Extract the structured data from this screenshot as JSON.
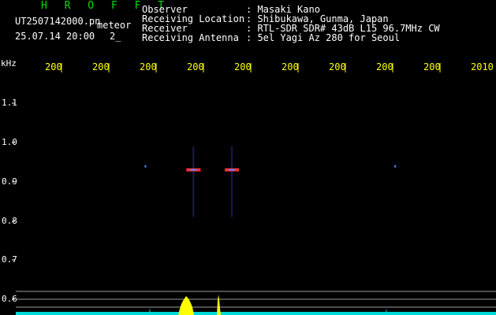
{
  "header": {
    "title": "H R O F F T",
    "filename": "UT2507142000.pn",
    "meteor_label": "meteor",
    "datetime": "25.07.14 20:00",
    "count": "2_"
  },
  "info": [
    {
      "key": "Observer",
      "value": ": Masaki Kano"
    },
    {
      "key": "Receiving Location",
      "value": ": Shibukawa, Gunma, Japan"
    },
    {
      "key": "Receiver",
      "value": ": RTL-SDR SDR# 43dB L15 96.7MHz CW"
    },
    {
      "key": "Receiving Antenna",
      "value": ": 5el Yagi Az 280 for Seoul"
    }
  ],
  "chart_data": {
    "type": "heatmap",
    "ylabel": "kHz",
    "x_ticks": [
      "200",
      "200",
      "200",
      "200",
      "200",
      "200",
      "200",
      "200",
      "200",
      "2010"
    ],
    "y_ticks": [
      "1.1",
      "1.0",
      "0.9",
      "0.8",
      "0.7",
      "0.6"
    ],
    "ylim": [
      0.6,
      1.1
    ],
    "colors": {
      "background": "#000000",
      "x_tick": "#ffff00",
      "y_tick": "#ffffff",
      "signal": "#ff3030",
      "echo_core": "#6080ff",
      "spectrum": "#ffff00",
      "baseline": "#00d8d8",
      "grid": "#9a9a9a"
    },
    "echoes": [
      {
        "x": 0.27,
        "f": 0.94,
        "intensity": "weak"
      },
      {
        "x": 0.37,
        "f": 0.93,
        "intensity": "strong"
      },
      {
        "x": 0.45,
        "f": 0.93,
        "intensity": "strong"
      },
      {
        "x": 0.79,
        "f": 0.94,
        "intensity": "weak"
      }
    ]
  }
}
